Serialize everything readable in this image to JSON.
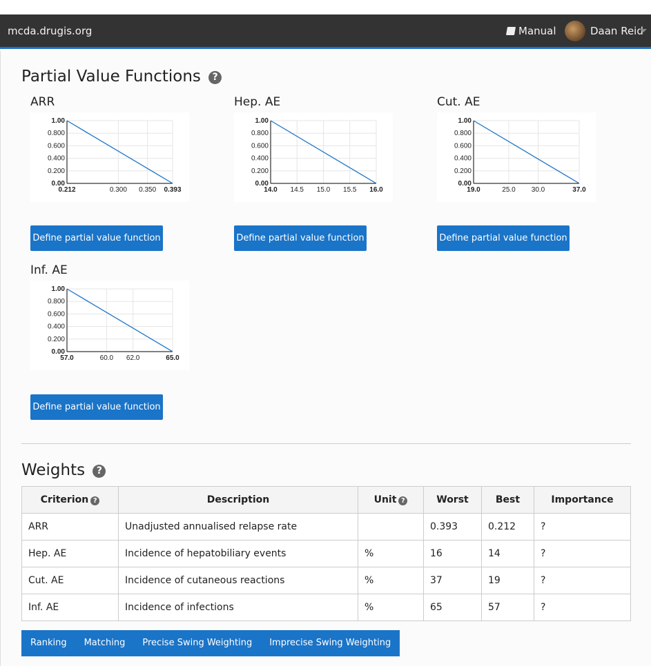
{
  "navbar": {
    "brand": "mcda.drugis.org",
    "manual_label": "Manual",
    "user_name": "Daan Reid"
  },
  "pvf": {
    "title": "Partial Value Functions",
    "button_label": "Define partial value function",
    "y_ticks": [
      "1.00",
      "0.800",
      "0.600",
      "0.400",
      "0.200",
      "0.00"
    ],
    "criteria": [
      {
        "name": "ARR",
        "x_ticks": [
          "0.212",
          "0.300",
          "0.350",
          "0.393"
        ],
        "x_bold": [
          true,
          false,
          false,
          true
        ]
      },
      {
        "name": "Hep. AE",
        "x_ticks": [
          "14.0",
          "14.5",
          "15.0",
          "15.5",
          "16.0"
        ],
        "x_bold": [
          true,
          false,
          false,
          false,
          true
        ]
      },
      {
        "name": "Cut. AE",
        "x_ticks": [
          "19.0",
          "25.0",
          "30.0",
          "37.0"
        ],
        "x_bold": [
          true,
          false,
          false,
          true
        ]
      },
      {
        "name": "Inf. AE",
        "x_ticks": [
          "57.0",
          "60.0",
          "62.0",
          "65.0"
        ],
        "x_bold": [
          true,
          false,
          false,
          true
        ]
      }
    ]
  },
  "weights": {
    "title": "Weights",
    "headers": {
      "criterion": "Criterion",
      "description": "Description",
      "unit": "Unit",
      "worst": "Worst",
      "best": "Best",
      "importance": "Importance"
    },
    "rows": [
      {
        "criterion": "ARR",
        "description": "Unadjusted annualised relapse rate",
        "unit": "",
        "worst": "0.393",
        "best": "0.212",
        "importance": "?"
      },
      {
        "criterion": "Hep. AE",
        "description": "Incidence of hepatobiliary events",
        "unit": "%",
        "worst": "16",
        "best": "14",
        "importance": "?"
      },
      {
        "criterion": "Cut. AE",
        "description": "Incidence of cutaneous reactions",
        "unit": "%",
        "worst": "37",
        "best": "19",
        "importance": "?"
      },
      {
        "criterion": "Inf. AE",
        "description": "Incidence of infections",
        "unit": "%",
        "worst": "65",
        "best": "57",
        "importance": "?"
      }
    ],
    "buttons": [
      "Ranking",
      "Matching",
      "Precise Swing Weighting",
      "Imprecise Swing Weighting"
    ]
  },
  "colors": {
    "navbar": "#333333",
    "primary": "#1a74c8",
    "line": "#1a74c8"
  }
}
